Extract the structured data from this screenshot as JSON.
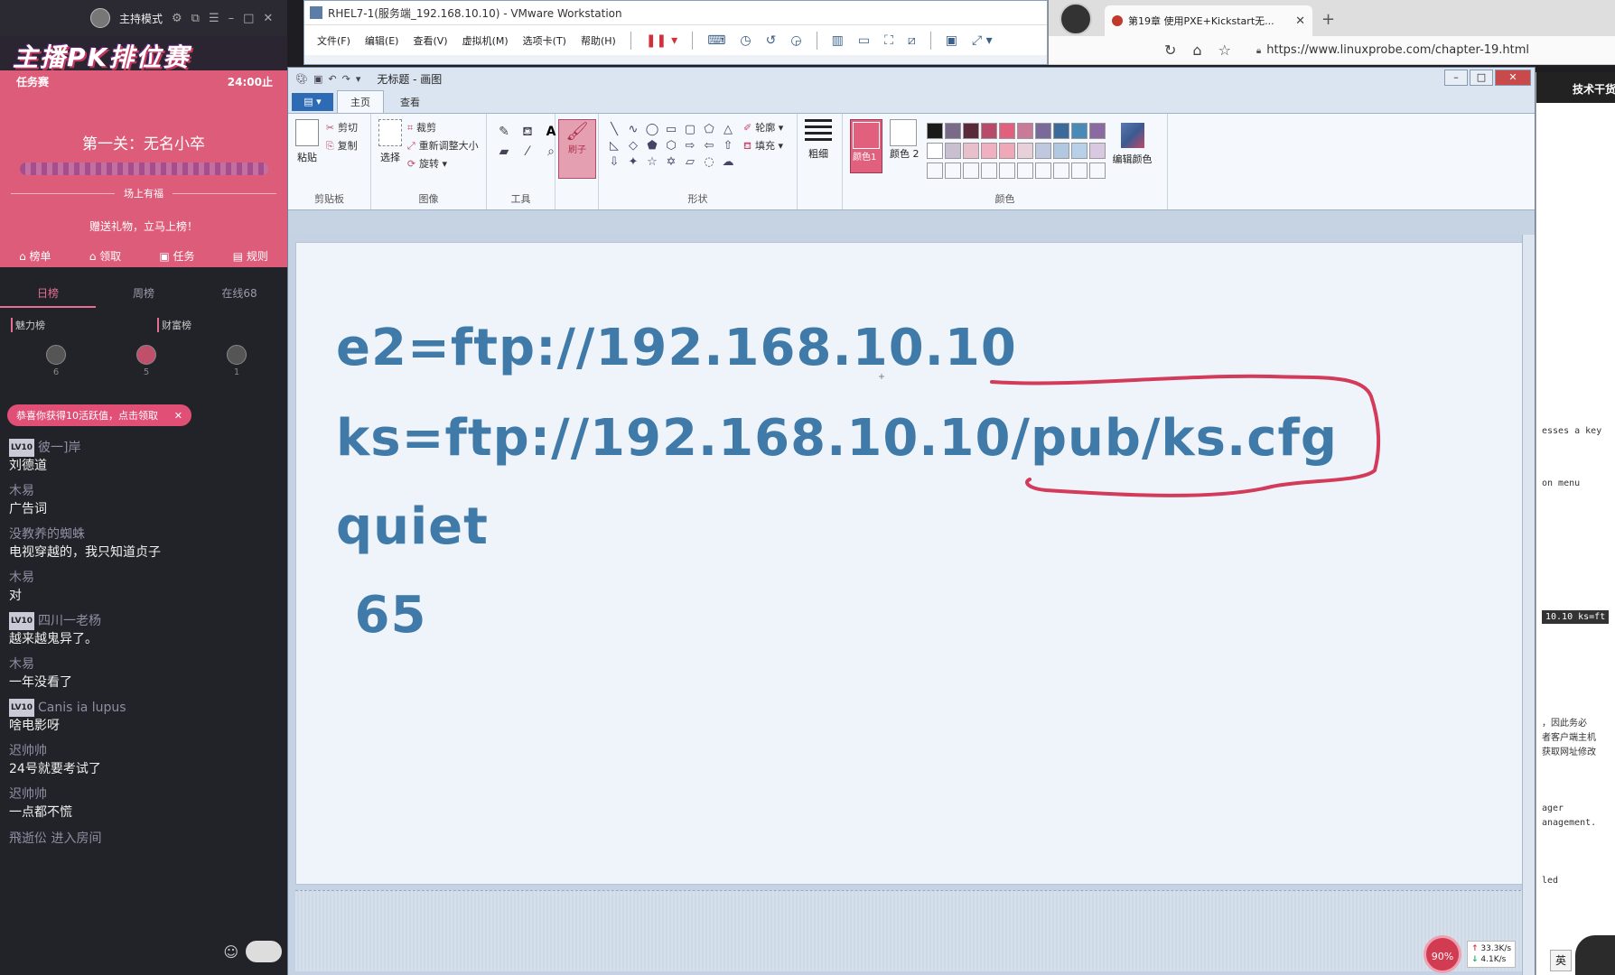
{
  "live": {
    "mode": "主持模式",
    "banner": "主播PK排位赛",
    "task_label": "任务赛",
    "time_label": "24:00止",
    "level_title": "第一关：无名小卒",
    "ranking_label": "场上有福",
    "cta": "赠送礼物，立马上榜！",
    "tabs": [
      "榜单",
      "领取",
      "任务",
      "规则"
    ],
    "subtabs": [
      "日榜",
      "周榜",
      "在线68"
    ],
    "charm_label": "魅力榜",
    "wealth_label": "财富榜",
    "ranks": [
      "6",
      "5",
      "1"
    ],
    "toast": "恭喜你获得10活跃值，点击领取",
    "chat": [
      {
        "user": "彼一]岸",
        "badge": "LV10",
        "text": "刘德道"
      },
      {
        "user": "木易",
        "badge": "",
        "text": "广告词"
      },
      {
        "user": "没教养的蜘蛛",
        "badge": "",
        "text": "电视穿越的，我只知道贞子"
      },
      {
        "user": "木易",
        "badge": "",
        "text": "对"
      },
      {
        "user": "四川一老杨",
        "badge": "LV10",
        "text": "越来越鬼异了。"
      },
      {
        "user": "木易",
        "badge": "",
        "text": "一年没看了"
      },
      {
        "user": "Canis ia lupus",
        "badge": "LV10",
        "text": "啥电影呀"
      },
      {
        "user": "迟帅帅",
        "badge": "",
        "text": "24号就要考试了"
      },
      {
        "user": "迟帅帅",
        "badge": "",
        "text": "一点都不慌"
      }
    ],
    "enter_notice": "飛逝伀 进入房间"
  },
  "vmware": {
    "title": "RHEL7-1(服务端_192.168.10.10) - VMware Workstation",
    "menu": [
      "文件(F)",
      "编辑(E)",
      "查看(V)",
      "虚拟机(M)",
      "选项卡(T)",
      "帮助(H)"
    ]
  },
  "browser": {
    "tab_title": "第19章 使用PXE+Kickstart无...",
    "url": "https://www.linuxprobe.com/chapter-19.html",
    "side_header": "技术干货",
    "side_snippets": [
      "esses a key",
      "on menu",
      "10.10 ks=ft",
      "，因此务必",
      "者客户端主机",
      "获取网址修改",
      "ager",
      "anagement.",
      "led"
    ]
  },
  "paint": {
    "title": "无标题 - 画图",
    "tabs": [
      "主页",
      "查看"
    ],
    "groups": {
      "clipboard": "剪贴板",
      "image": "图像",
      "tools": "工具",
      "shapes": "形状",
      "colors": "颜色"
    },
    "paste": "粘贴",
    "cut": "剪切",
    "copy": "复制",
    "select": "选择",
    "crop": "裁剪",
    "resize": "重新调整大小",
    "rotate": "旋转",
    "brushes": "刷子",
    "outline": "轮廓",
    "fill": "填充",
    "size": "粗细",
    "color1": "颜色1",
    "color2": "颜色 2",
    "edit_colors": "编辑颜色",
    "canvas_lines": [
      "e2=ftp://192.168.10.10",
      "ks=ftp://192.168.10.10/pub/ks.cfg",
      "quiet",
      " 65"
    ],
    "palette_row1": [
      "#1a1a1a",
      "#7a6a8a",
      "#5a2a3a",
      "#b84a6a",
      "#e0607e",
      "#c87a98",
      "#7a6a9a",
      "#3a6a9a",
      "#4a8ab8",
      "#8a6aa0"
    ],
    "palette_row2": [
      "#ffffff",
      "#c8c0d0",
      "#e8c0cc",
      "#f0b0c0",
      "#f0a8b8",
      "#e8d0da",
      "#c0c8e0",
      "#b0c8e0",
      "#b8d0e8",
      "#d8c8e0"
    ],
    "accent": "#e0607e",
    "annotation_color": "#d23c5a"
  },
  "tray": {
    "percent": "90%",
    "up": "33.3K/s",
    "down": "4.1K/s",
    "ime": "英"
  }
}
